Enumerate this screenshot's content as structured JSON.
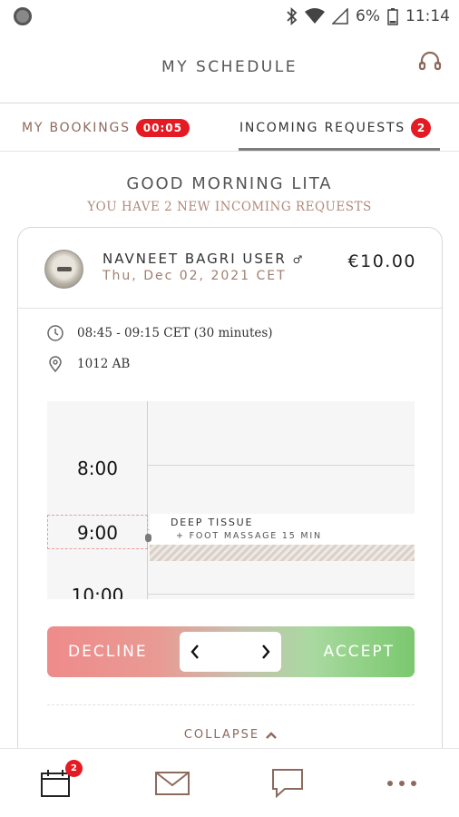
{
  "status_bar": {
    "battery": "6%",
    "time": "11:14"
  },
  "header": {
    "title": "MY SCHEDULE"
  },
  "tabs": {
    "bookings_label": "MY BOOKINGS",
    "bookings_timer": "00:05",
    "requests_label": "INCOMING REQUESTS",
    "requests_count": "2"
  },
  "greeting": {
    "title": "GOOD MORNING LITA",
    "subtitle": "YOU HAVE 2 NEW INCOMING REQUESTS"
  },
  "request": {
    "client_name": "NAVNEET BAGRI USER",
    "gender_symbol": "♂",
    "date": "Thu, Dec 02, 2021 CET",
    "price": "€10.00",
    "time": "08:45 - 09:15 CET (30 minutes)",
    "location": "1012 AB",
    "calendar": {
      "hours": [
        "8:00",
        "9:00",
        "10:00"
      ],
      "event_title": "DEEP TISSUE",
      "event_subtitle": "+ FOOT MASSAGE 15 MIN"
    },
    "decline_label": "DECLINE",
    "accept_label": "ACCEPT",
    "collapse_label": "COLLAPSE"
  },
  "bottom_nav": {
    "calendar_badge": "2"
  },
  "colors": {
    "accent_brown": "#8c6a5e",
    "badge_red": "#e51b23",
    "decline_red": "#ee8b8b",
    "accept_green": "#7ac86e"
  }
}
